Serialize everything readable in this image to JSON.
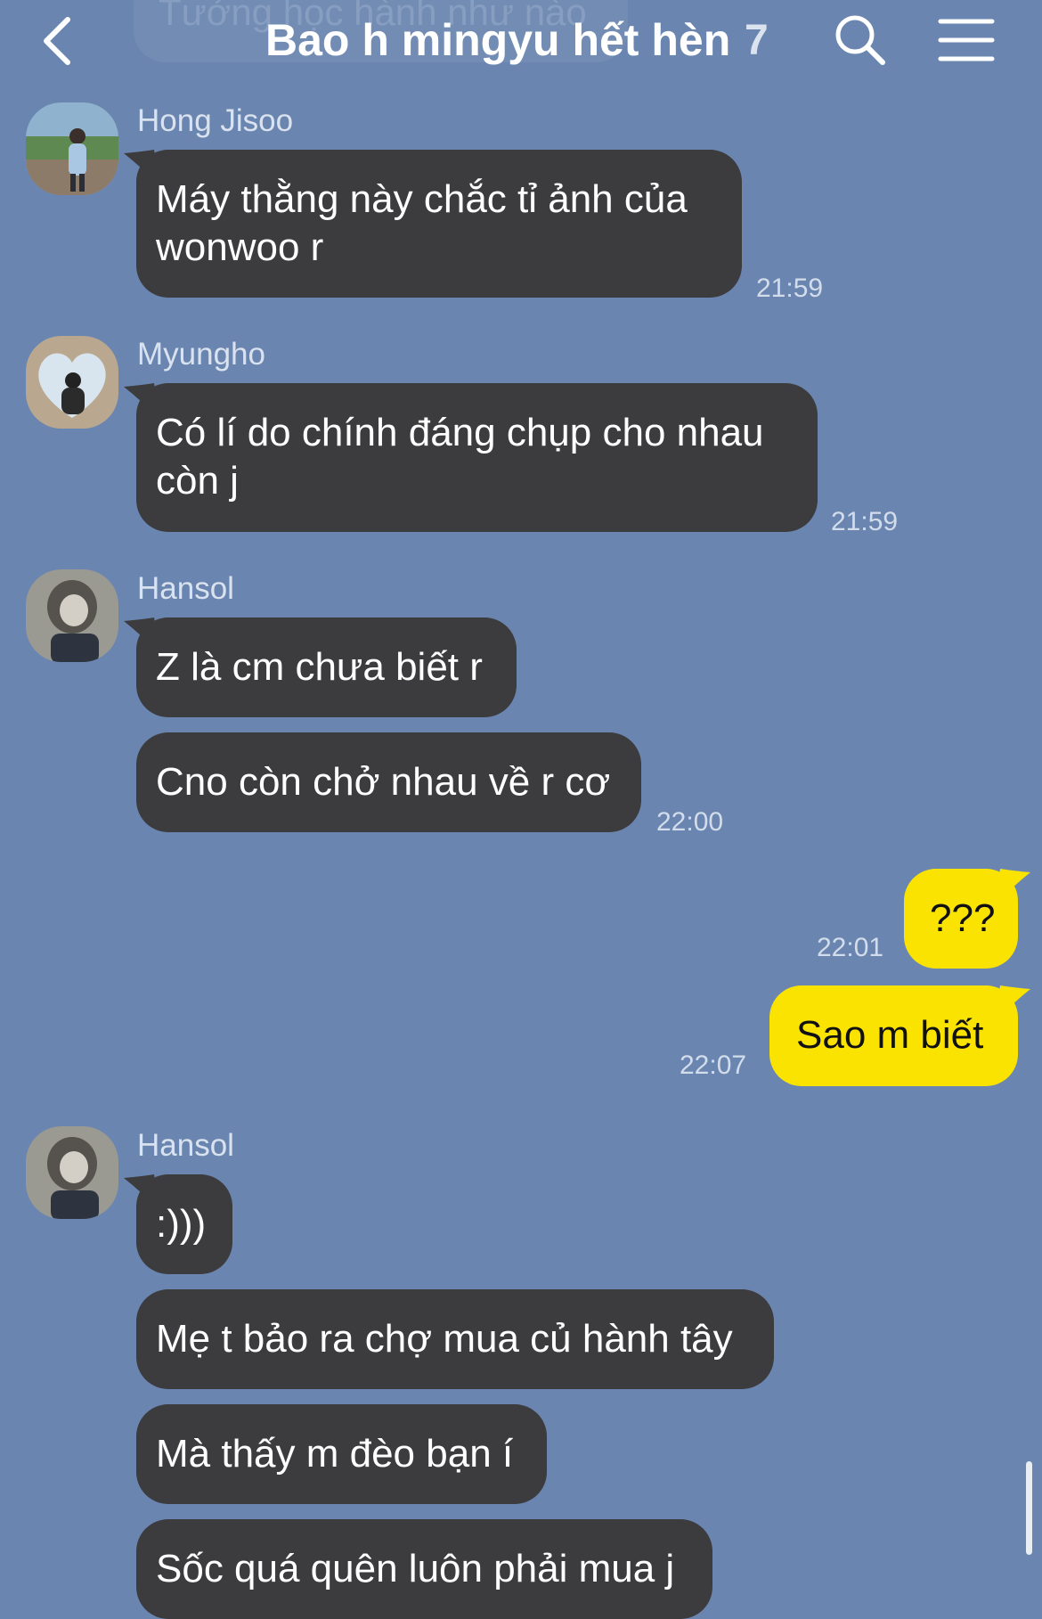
{
  "header": {
    "ghost_text": "Tưởng học hành như nào",
    "title": "Bao h mingyu hết hèn",
    "member_count": "7",
    "icons": [
      "back-icon",
      "search-icon",
      "menu-icon"
    ]
  },
  "colors": {
    "background": "#6a86b0",
    "incoming_bubble": "#3c3b3e",
    "outgoing_bubble": "#fae300"
  },
  "messages": [
    {
      "sender": "Hong Jisoo",
      "lines": [
        "Máy thằng này chắc tỉ ảnh của",
        "wonwoo r"
      ],
      "time": "21:59"
    },
    {
      "sender": "Myungho",
      "lines": [
        "Có lí do chính đáng chụp cho nhau",
        "còn j"
      ],
      "time": "21:59"
    },
    {
      "sender": "Hansol",
      "text": "Z là cm chưa biết r"
    },
    {
      "text": "Cno còn chở nhau về r cơ",
      "time": "22:00"
    },
    {
      "mine": true,
      "text": "???",
      "time": "22:01"
    },
    {
      "mine": true,
      "text": "Sao m biết",
      "time": "22:07"
    },
    {
      "sender": "Hansol",
      "text": ":)))"
    },
    {
      "text": "Mẹ t bảo ra chợ mua củ hành tây"
    },
    {
      "text": "Mà thấy m đèo bạn í"
    },
    {
      "text": "Sốc quá quên luôn phải mua j"
    }
  ]
}
